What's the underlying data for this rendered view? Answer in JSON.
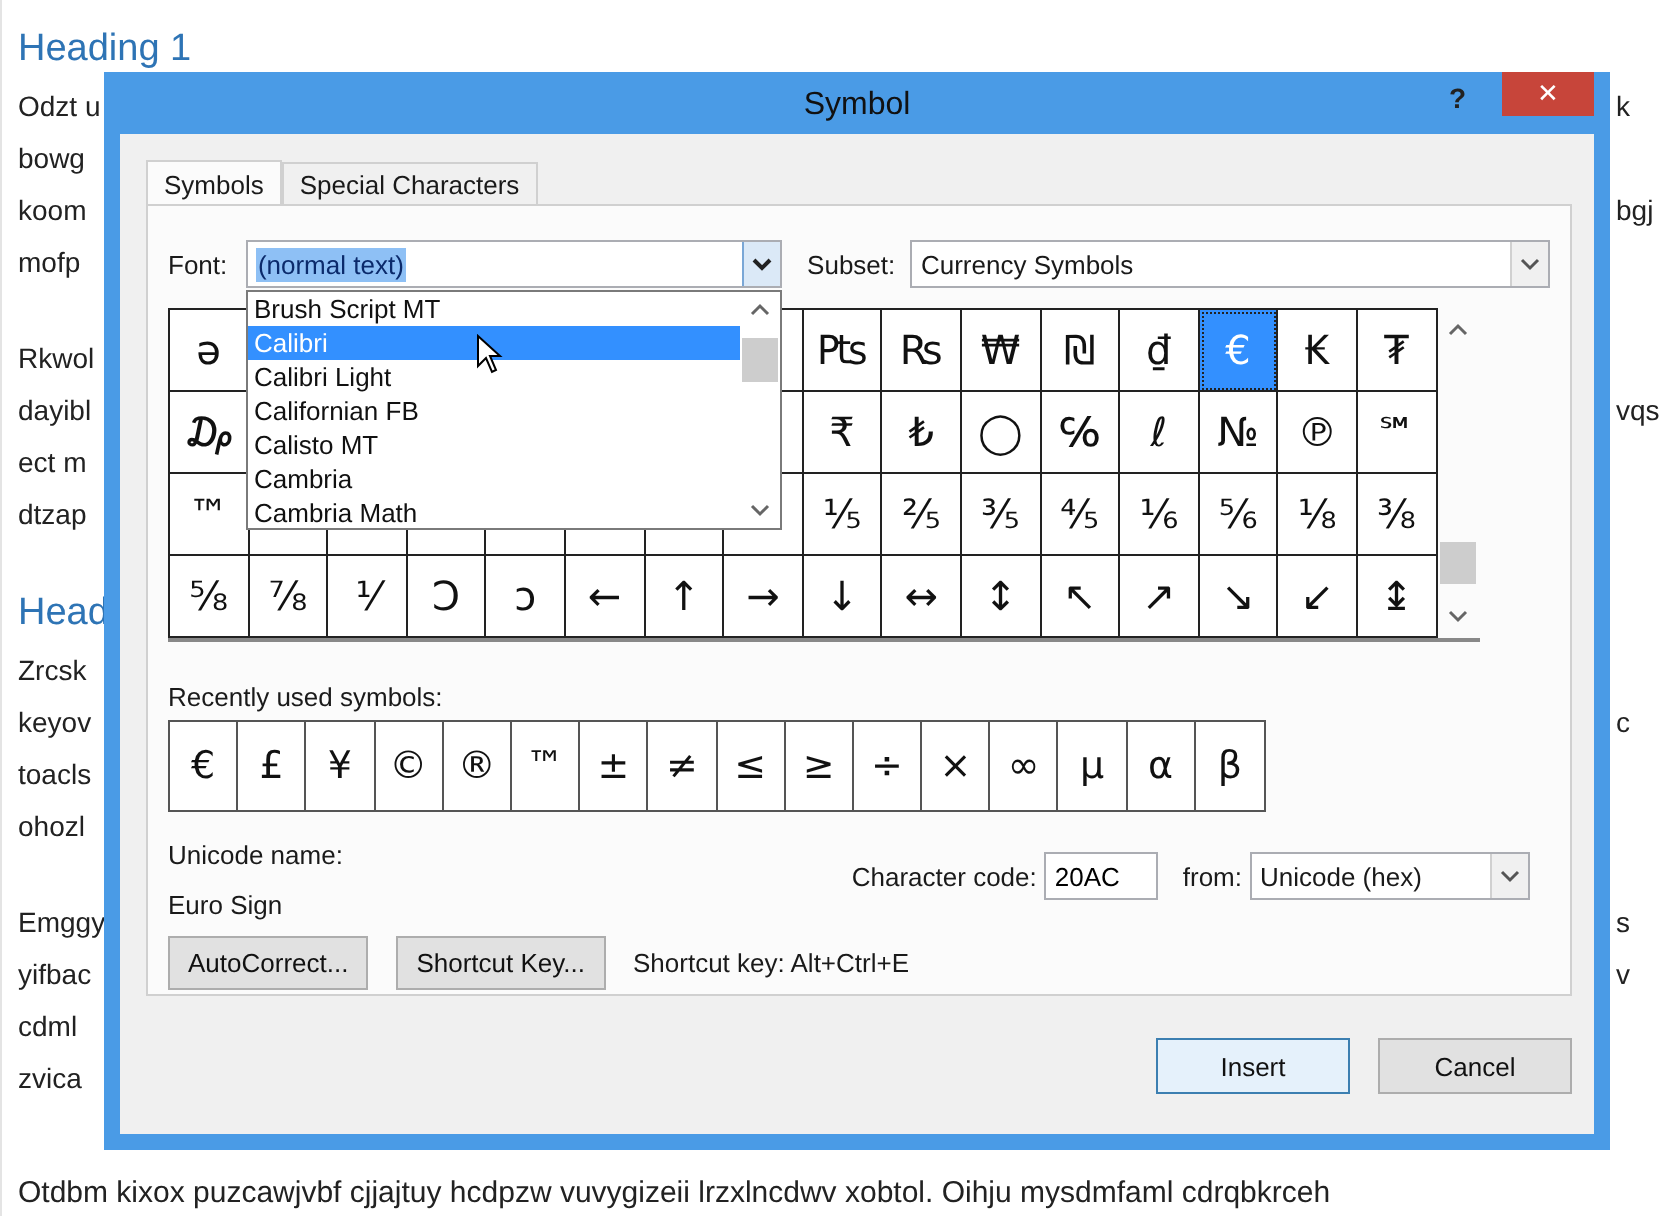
{
  "document": {
    "blocks": [
      {
        "kind": "heading",
        "lines": [
          {
            "left": "Heading 1"
          }
        ]
      },
      {
        "kind": "paragraph",
        "lines": [
          {
            "left": "Odzt u",
            "right": "k"
          },
          {
            "left": "bowg"
          },
          {
            "left": "koom",
            "right": "bgj"
          },
          {
            "left": "mofp"
          }
        ]
      },
      {
        "kind": "paragraph",
        "lines": [
          {
            "left": "Rkwol"
          },
          {
            "left": "dayibl",
            "right": "vqs"
          },
          {
            "left": "ect m"
          },
          {
            "left": "dtzap"
          }
        ]
      },
      {
        "kind": "heading",
        "lines": [
          {
            "left": "Head"
          }
        ]
      },
      {
        "kind": "paragraph",
        "lines": [
          {
            "left": "Zrcsk"
          },
          {
            "left": "keyov",
            "right": "c"
          },
          {
            "left": "toacls"
          },
          {
            "left": "ohozl"
          }
        ]
      },
      {
        "kind": "paragraph",
        "lines": [
          {
            "left": "Emggy",
            "right": "s"
          },
          {
            "left": "yifbac",
            "right": "v"
          },
          {
            "left": "cdml"
          },
          {
            "left": "zvica"
          }
        ]
      }
    ],
    "bottom_line": "Otdbm kixox puzcawjvbf cjjajtuy hcdpzw vuvygizeii lrzxlncdwv xobtol. Oihju mysdmfaml cdrqbkrceh"
  },
  "dialog": {
    "title": "Symbol",
    "help": "?",
    "close": "✕",
    "tabs": [
      {
        "label": "Symbols",
        "selected": true
      },
      {
        "label": "Special Characters",
        "selected": false
      }
    ],
    "font": {
      "label": "Font:",
      "value": "(normal text)"
    },
    "font_list": [
      {
        "name": "Brush Script MT",
        "selected": false
      },
      {
        "name": "Calibri",
        "selected": true
      },
      {
        "name": "Calibri Light",
        "selected": false
      },
      {
        "name": "Californian FB",
        "selected": false
      },
      {
        "name": "Calisto MT",
        "selected": false
      },
      {
        "name": "Cambria",
        "selected": false
      },
      {
        "name": "Cambria Math",
        "selected": false
      }
    ],
    "subset": {
      "label": "Subset:",
      "value": "Currency Symbols"
    },
    "grid": {
      "rows": [
        {
          "cells": [
            {
              "char": "ə",
              "selected": false
            },
            null,
            null,
            null,
            null,
            null,
            null,
            null,
            {
              "char": "₧",
              "selected": false
            },
            {
              "char": "₨",
              "selected": false
            },
            {
              "char": "₩",
              "selected": false
            },
            {
              "char": "₪",
              "selected": false
            },
            {
              "char": "₫",
              "selected": false
            },
            {
              "char": "€",
              "selected": true
            },
            {
              "char": "₭",
              "selected": false
            },
            {
              "char": "₮",
              "selected": false
            }
          ]
        },
        {
          "cells": [
            {
              "char": "₯",
              "selected": false
            },
            null,
            null,
            null,
            null,
            null,
            null,
            null,
            {
              "char": "₹",
              "selected": false
            },
            {
              "char": "₺",
              "selected": false
            },
            {
              "char": "◯",
              "selected": false
            },
            {
              "char": "℅",
              "selected": false
            },
            {
              "char": "ℓ",
              "selected": false
            },
            {
              "char": "№",
              "selected": false
            },
            {
              "char": "℗",
              "selected": false
            },
            {
              "char": "℠",
              "selected": false
            }
          ]
        },
        {
          "cells": [
            {
              "char": "™",
              "selected": false
            },
            null,
            null,
            null,
            null,
            null,
            null,
            null,
            {
              "char": "⅕",
              "selected": false
            },
            {
              "char": "⅖",
              "selected": false
            },
            {
              "char": "⅗",
              "selected": false
            },
            {
              "char": "⅘",
              "selected": false
            },
            {
              "char": "⅙",
              "selected": false
            },
            {
              "char": "⅚",
              "selected": false
            },
            {
              "char": "⅛",
              "selected": false
            },
            {
              "char": "⅜",
              "selected": false
            }
          ]
        },
        {
          "cells": [
            {
              "char": "⅝",
              "selected": false
            },
            {
              "char": "⅞",
              "selected": false
            },
            {
              "char": "⅟",
              "selected": false
            },
            {
              "char": "Ↄ",
              "selected": false
            },
            {
              "char": "ↄ",
              "selected": false
            },
            {
              "char": "←",
              "selected": false
            },
            {
              "char": "↑",
              "selected": false
            },
            {
              "char": "→",
              "selected": false
            },
            {
              "char": "↓",
              "selected": false
            },
            {
              "char": "↔",
              "selected": false
            },
            {
              "char": "↕",
              "selected": false
            },
            {
              "char": "↖",
              "selected": false
            },
            {
              "char": "↗",
              "selected": false
            },
            {
              "char": "↘",
              "selected": false
            },
            {
              "char": "↙",
              "selected": false
            },
            {
              "char": "↨",
              "selected": false
            }
          ]
        }
      ]
    },
    "recent": {
      "label": "Recently used symbols:",
      "symbols": [
        "€",
        "£",
        "¥",
        "©",
        "®",
        "™",
        "±",
        "≠",
        "≤",
        "≥",
        "÷",
        "×",
        "∞",
        "µ",
        "α",
        "β"
      ]
    },
    "unicode_name": {
      "label": "Unicode name:",
      "value": "Euro Sign"
    },
    "character_code": {
      "label": "Character code:",
      "value": "20AC"
    },
    "from": {
      "label": "from:",
      "value": "Unicode (hex)"
    },
    "buttons": [
      {
        "label": "AutoCorrect..."
      },
      {
        "label": "Shortcut Key..."
      }
    ],
    "shortcut_text": "Shortcut key: Alt+Ctrl+E",
    "actions": [
      {
        "label": "Insert",
        "default": true
      },
      {
        "label": "Cancel",
        "default": false
      }
    ]
  }
}
